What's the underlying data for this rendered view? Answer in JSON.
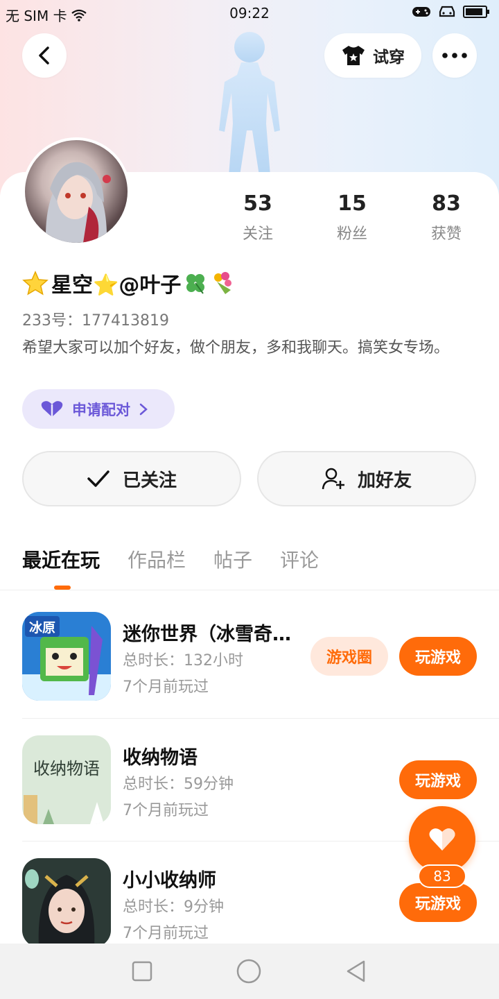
{
  "status_bar": {
    "carrier": "无 SIM 卡",
    "time": "09:22"
  },
  "header": {
    "tryon_label": "试穿"
  },
  "stats": [
    {
      "value": "53",
      "label": "关注"
    },
    {
      "value": "15",
      "label": "粉丝"
    },
    {
      "value": "83",
      "label": "获赞"
    }
  ],
  "profile": {
    "nickname": "星空⭐@叶子",
    "uid": "233号：177413819",
    "bio": "希望大家可以加个好友，做个朋友，多和我聊天。搞笑女专场。",
    "pair_label": "申请配对"
  },
  "actions": {
    "follow_label": "已关注",
    "add_friend_label": "加好友"
  },
  "tabs": [
    "最近在玩",
    "作品栏",
    "帖子",
    "评论"
  ],
  "games": [
    {
      "title": "迷你世界（冰雪奇缘）",
      "time": "总时长：132小时",
      "last": "7个月前玩过",
      "circle_label": "游戏圈",
      "play_label": "玩游戏",
      "icon_text": "冰原"
    },
    {
      "title": "收纳物语",
      "time": "总时长：59分钟",
      "last": "7个月前玩过",
      "play_label": "玩游戏",
      "icon_text": "收纳物语"
    },
    {
      "title": "小小收纳师",
      "time": "总时长：9分钟",
      "last": "7个月前玩过",
      "play_label": "玩游戏"
    }
  ],
  "like": {
    "count": "83"
  },
  "colors": {
    "accent": "#ff6b0a",
    "pair": "#6b58d8"
  }
}
